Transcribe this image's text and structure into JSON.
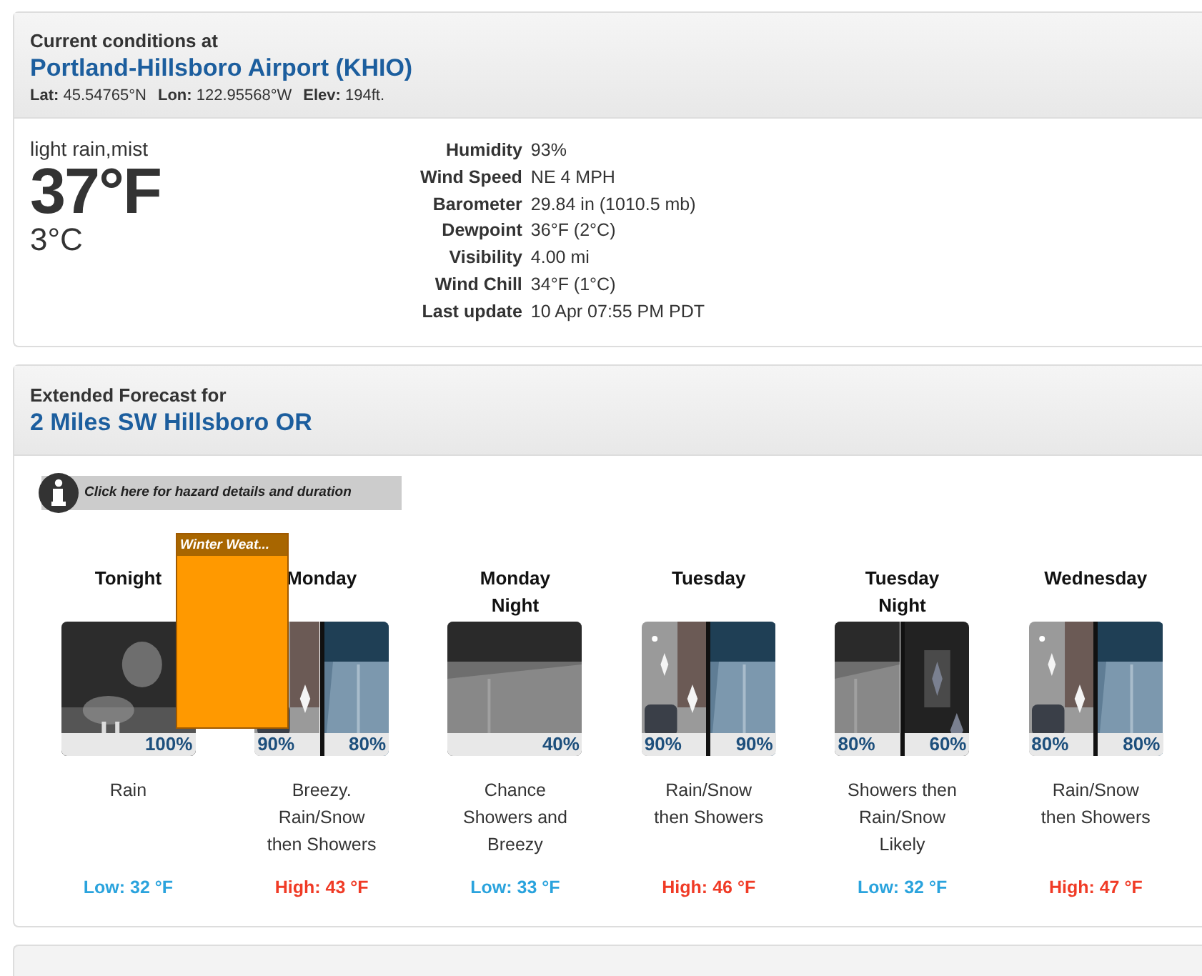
{
  "current": {
    "heading": "Current conditions at",
    "station": "Portland-Hillsboro Airport (KHIO)",
    "coords": [
      {
        "label": "Lat:",
        "value": "45.54765°N"
      },
      {
        "label": "Lon:",
        "value": "122.95568°W"
      },
      {
        "label": "Elev:",
        "value": "194ft."
      }
    ],
    "summary": "light rain,mist",
    "temp_f": "37°F",
    "temp_c": "3°C",
    "details": [
      {
        "label": "Humidity",
        "value": "93%"
      },
      {
        "label": "Wind Speed",
        "value": "NE 4 MPH"
      },
      {
        "label": "Barometer",
        "value": "29.84 in (1010.5 mb)"
      },
      {
        "label": "Dewpoint",
        "value": "36°F (2°C)"
      },
      {
        "label": "Visibility",
        "value": "4.00 mi"
      },
      {
        "label": "Wind Chill",
        "value": "34°F (1°C)"
      },
      {
        "label": "Last update",
        "value": "10 Apr 07:55 PM PDT"
      }
    ]
  },
  "forecast": {
    "heading": "Extended Forecast for",
    "place": "2 Miles SW Hillsboro OR",
    "hazard_link": "Click here for hazard details and duration",
    "hazard_banner": "Winter Weat...",
    "periods": [
      {
        "name": "Tonight",
        "segments": [
          {
            "kind": "night-rain",
            "pop": "100%"
          }
        ],
        "description": "Rain",
        "temp": "Low: 32 °F",
        "kind": "low"
      },
      {
        "name": "Monday",
        "segments": [
          {
            "kind": "snow",
            "pop": "90%"
          },
          {
            "kind": "showers",
            "pop": "80%"
          }
        ],
        "description": "Breezy. Rain/Snow then Showers",
        "temp": "High: 43 °F",
        "kind": "high"
      },
      {
        "name": "Monday Night",
        "segments": [
          {
            "kind": "dark-showers",
            "pop": "40%"
          }
        ],
        "description": "Chance Showers and Breezy",
        "temp": "Low: 33 °F",
        "kind": "low"
      },
      {
        "name": "Tuesday",
        "segments": [
          {
            "kind": "snow",
            "pop": "90%"
          },
          {
            "kind": "showers",
            "pop": "90%"
          }
        ],
        "description": "Rain/Snow then Showers",
        "temp": "High: 46 °F",
        "kind": "high"
      },
      {
        "name": "Tuesday Night",
        "segments": [
          {
            "kind": "dark-showers",
            "pop": "80%"
          },
          {
            "kind": "night-snow",
            "pop": "60%"
          }
        ],
        "description": "Showers then Rain/Snow Likely",
        "temp": "Low: 32 °F",
        "kind": "low"
      },
      {
        "name": "Wednesday",
        "segments": [
          {
            "kind": "snow",
            "pop": "80%"
          },
          {
            "kind": "showers",
            "pop": "80%"
          }
        ],
        "description": "Rain/Snow then Showers",
        "temp": "High: 47 °F",
        "kind": "high"
      }
    ]
  }
}
